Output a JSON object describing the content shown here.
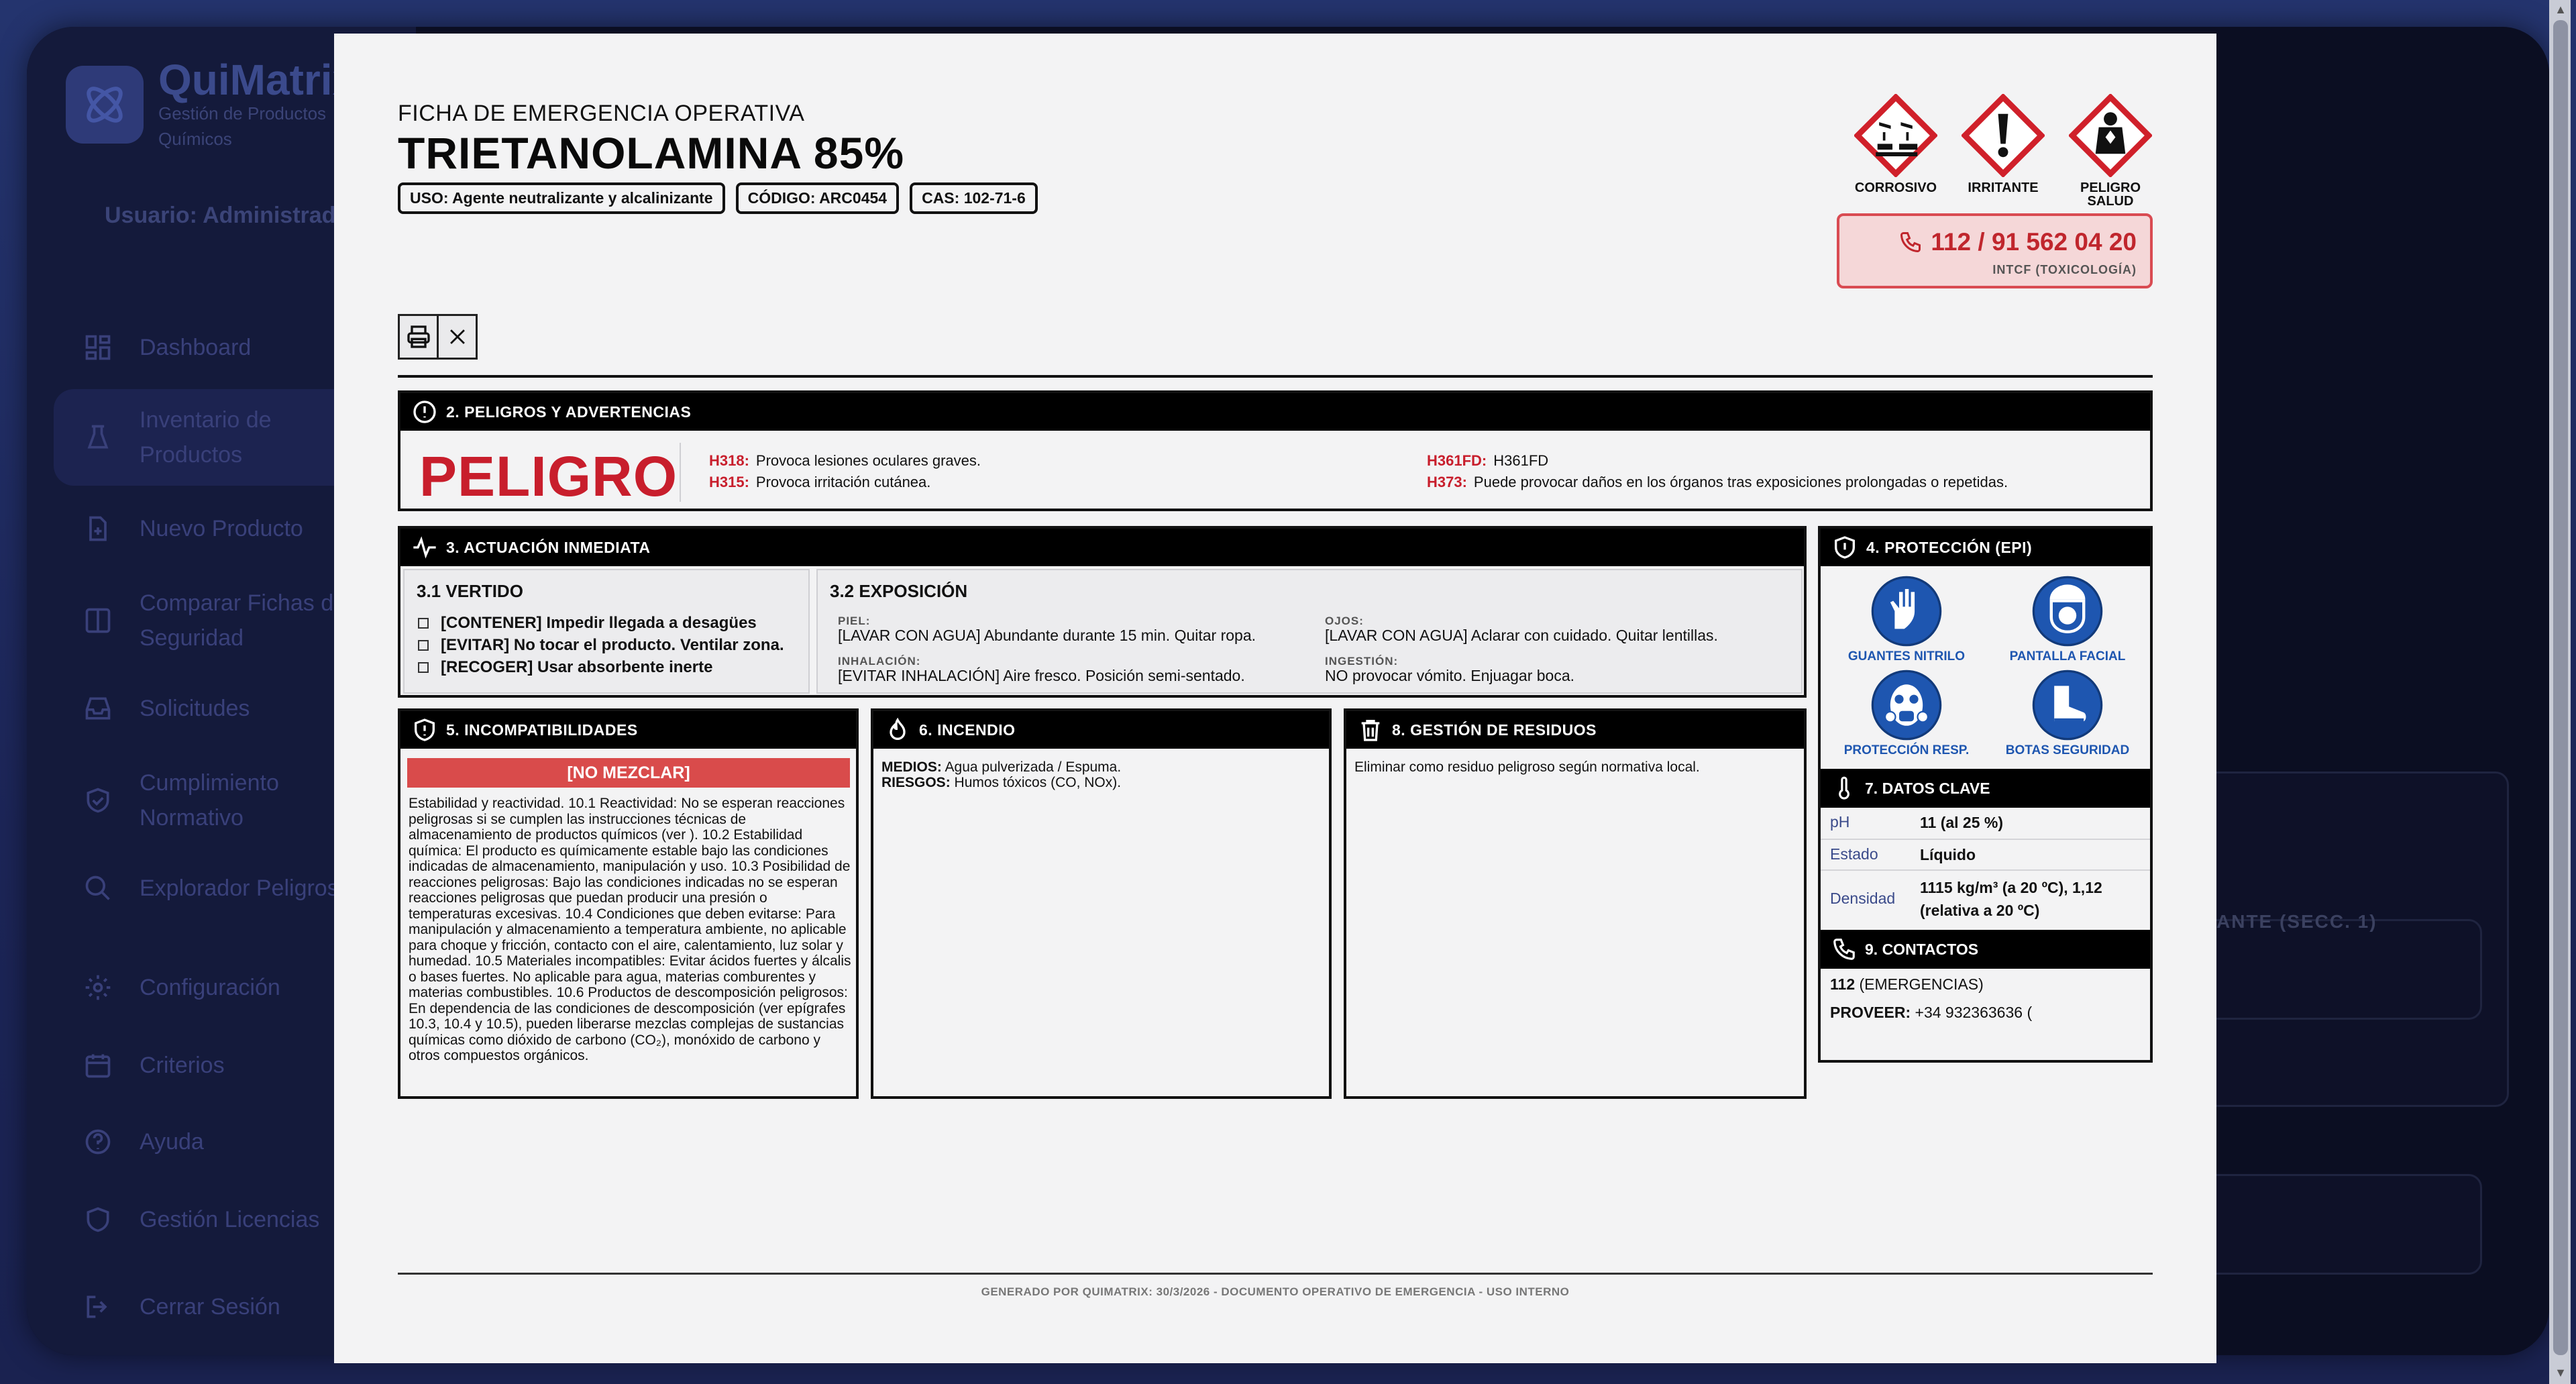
{
  "app": {
    "logo_title": "QuiMatrix",
    "logo_subtitle": "Gestión de Productos Químicos",
    "user_label": "Usuario: Administrador",
    "nav": [
      {
        "label": "Dashboard",
        "icon": "grid-icon"
      },
      {
        "label": "Inventario de Productos",
        "icon": "flask-icon"
      },
      {
        "label": "Nuevo Producto",
        "icon": "file-plus-icon"
      },
      {
        "label": "Comparar Fichas de Seguridad",
        "icon": "columns-icon"
      },
      {
        "label": "Solicitudes",
        "icon": "inbox-icon"
      },
      {
        "label": "Cumplimiento Normativo",
        "icon": "shield-check-icon"
      },
      {
        "label": "Explorador Peligros",
        "icon": "search-icon"
      },
      {
        "label": "Configuración",
        "icon": "gear-icon"
      },
      {
        "label": "Criterios",
        "icon": "calendar-icon"
      },
      {
        "label": "Ayuda",
        "icon": "help-icon"
      },
      {
        "label": "Gestión Licencias",
        "icon": "shield-icon"
      },
      {
        "label": "Cerrar Sesión",
        "icon": "logout-icon"
      }
    ],
    "bg_text": "ANTE (SECC. 1)"
  },
  "doc": {
    "kicker": "FICHA DE EMERGENCIA OPERATIVA",
    "title": "TRIETANOLAMINA 85%",
    "tags": [
      "USO: Agente neutralizante y alcalinizante",
      "CÓDIGO: ARC0454",
      "CAS: 102-71-6"
    ],
    "ghs": [
      {
        "label": "CORROSIVO",
        "icon": "ghs-corrosive-icon"
      },
      {
        "label": "IRRITANTE",
        "icon": "ghs-exclamation-icon"
      },
      {
        "label": "PELIGRO SALUD",
        "icon": "ghs-health-hazard-icon"
      }
    ],
    "emergency": {
      "phone": "112 / 91 562 04 20",
      "sub": "INTCF (TOXICOLOGÍA)"
    },
    "colors": {
      "danger": "#c81e2c",
      "epi_blue": "#1e56b0",
      "nomix": "#d94b4b"
    }
  },
  "sec2": {
    "title": "2. PELIGROS Y ADVERTENCIAS",
    "signal": "PELIGRO",
    "hazards": [
      {
        "code": "H318:",
        "text": "Provoca lesiones oculares graves."
      },
      {
        "code": "H315:",
        "text": "Provoca irritación cutánea."
      },
      {
        "code": "H361FD:",
        "text": "H361FD"
      },
      {
        "code": "H373:",
        "text": "Puede provocar daños en los órganos tras exposiciones prolongadas o repetidas."
      }
    ]
  },
  "sec3": {
    "title": "3. ACTUACIÓN INMEDIATA",
    "spill_title": "3.1 VERTIDO",
    "spill": [
      "[CONTENER] Impedir llegada a desagües",
      "[EVITAR] No tocar el producto. Ventilar zona.",
      "[RECOGER] Usar absorbente inerte"
    ],
    "exposure_title": "3.2 EXPOSICIÓN",
    "exposure": {
      "skin_label": "PIEL:",
      "skin": "[LAVAR CON AGUA] Abundante durante 15 min. Quitar ropa.",
      "eyes_label": "OJOS:",
      "eyes": "[LAVAR CON AGUA] Aclarar con cuidado. Quitar lentillas.",
      "inhal_label": "INHALACIÓN:",
      "inhal": "[EVITAR INHALACIÓN] Aire fresco. Posición semi-sentado.",
      "ingest_label": "INGESTIÓN:",
      "ingest": "NO provocar vómito. Enjuagar boca."
    }
  },
  "sec4": {
    "title": "4. PROTECCIÓN (EPI)",
    "epi": [
      {
        "label": "GUANTES NITRILO",
        "icon": "gloves-icon"
      },
      {
        "label": "PANTALLA FACIAL",
        "icon": "face-shield-icon"
      },
      {
        "label": "PROTECCIÓN RESP.",
        "icon": "respirator-icon"
      },
      {
        "label": "BOTAS SEGURIDAD",
        "icon": "boots-icon"
      }
    ]
  },
  "sec7": {
    "title": "7. DATOS CLAVE",
    "rows": [
      {
        "key": "pH",
        "value": "11 (al 25 %)"
      },
      {
        "key": "Estado",
        "value": "Líquido"
      },
      {
        "key": "Densidad",
        "value": "1115 kg/m³ (a 20 ºC), 1,12 (relativa a 20 ºC)"
      }
    ]
  },
  "sec9": {
    "title": "9. CONTACTOS",
    "emergency_num": "112",
    "emergency_label": "(EMERGENCIAS)",
    "supplier_label": "PROVEER:",
    "supplier": "+34 932363636 ("
  },
  "sec5": {
    "title": "5. INCOMPATIBILIDADES",
    "banner": "[NO MEZCLAR]",
    "text": "Estabilidad y reactividad. 10.1 Reactividad: No se esperan reacciones peligrosas si se cumplen las instrucciones técnicas de almacenamiento de productos químicos (ver ). 10.2 Estabilidad química: El producto es químicamente estable bajo las condiciones indicadas de almacenamiento, manipulación y uso. 10.3 Posibilidad de reacciones peligrosas: Bajo las condiciones indicadas no se esperan reacciones peligrosas que puedan producir una presión o temperaturas excesivas. 10.4 Condiciones que deben evitarse: Para manipulación y almacenamiento a temperatura ambiente, no aplicable para choque y fricción, contacto con el aire, calentamiento, luz solar y humedad. 10.5 Materiales incompatibles: Evitar ácidos fuertes y álcalis o bases fuertes. No aplicable para agua, materias comburentes y materias combustibles. 10.6 Productos de descomposición peligrosos: En dependencia de las condiciones de descomposición (ver epígrafes 10.3, 10.4 y 10.5), pueden liberarse mezclas complejas de sustancias químicas como dióxido de carbono (CO₂), monóxido de carbono y otros compuestos orgánicos."
  },
  "sec6": {
    "title": "6. INCENDIO",
    "media_label": "MEDIOS:",
    "media": "Agua pulverizada / Espuma.",
    "risks_label": "RIESGOS:",
    "risks": "Humos tóxicos (CO, NOx)."
  },
  "sec8": {
    "title": "8. GESTIÓN DE RESIDUOS",
    "text": "Eliminar como residuo peligroso según normativa local."
  },
  "footer": "GENERADO POR QUIMATRIX: 30/3/2026 - DOCUMENTO OPERATIVO DE EMERGENCIA - USO INTERNO"
}
